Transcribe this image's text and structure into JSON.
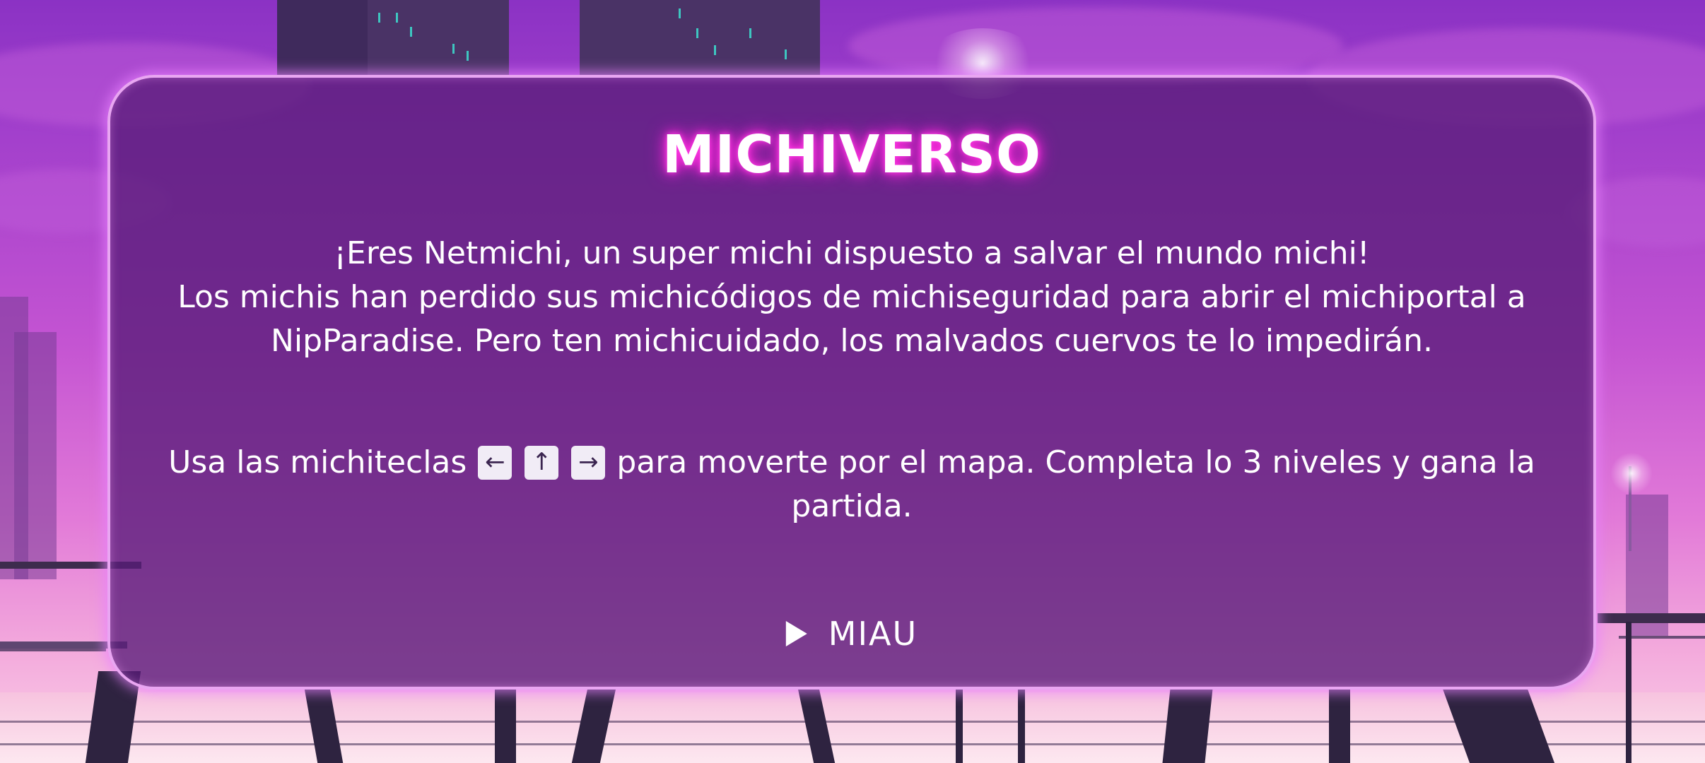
{
  "game": {
    "title": "MICHIVERSO",
    "story": {
      "line1": "¡Eres Netmichi, un super michi dispuesto a salvar el mundo michi!",
      "line2": "Los michis han perdido sus michicódigos de michiseguridad para abrir el michiportal a NipParadise. Pero ten michicuidado, los malvados cuervos te lo impedirán."
    },
    "controls": {
      "prefix": "Usa las michiteclas",
      "keys": [
        {
          "icon": "arrow-left-key-icon",
          "glyph": "←"
        },
        {
          "icon": "arrow-up-key-icon",
          "glyph": "↑"
        },
        {
          "icon": "arrow-right-key-icon",
          "glyph": "→"
        }
      ],
      "suffix": "para moverte por el mapa. Completa lo 3 niveles y gana la partida."
    },
    "play_button": {
      "icon": "play-icon",
      "label": "MIAU"
    }
  },
  "colors": {
    "dialog_background": "#581c78",
    "dialog_border": "#e9a6f2",
    "title_glow": "#ff2ad8",
    "key_background": "#f1ecf6",
    "sky_top": "#8b32c4",
    "sky_bottom": "#fbd2e8"
  }
}
